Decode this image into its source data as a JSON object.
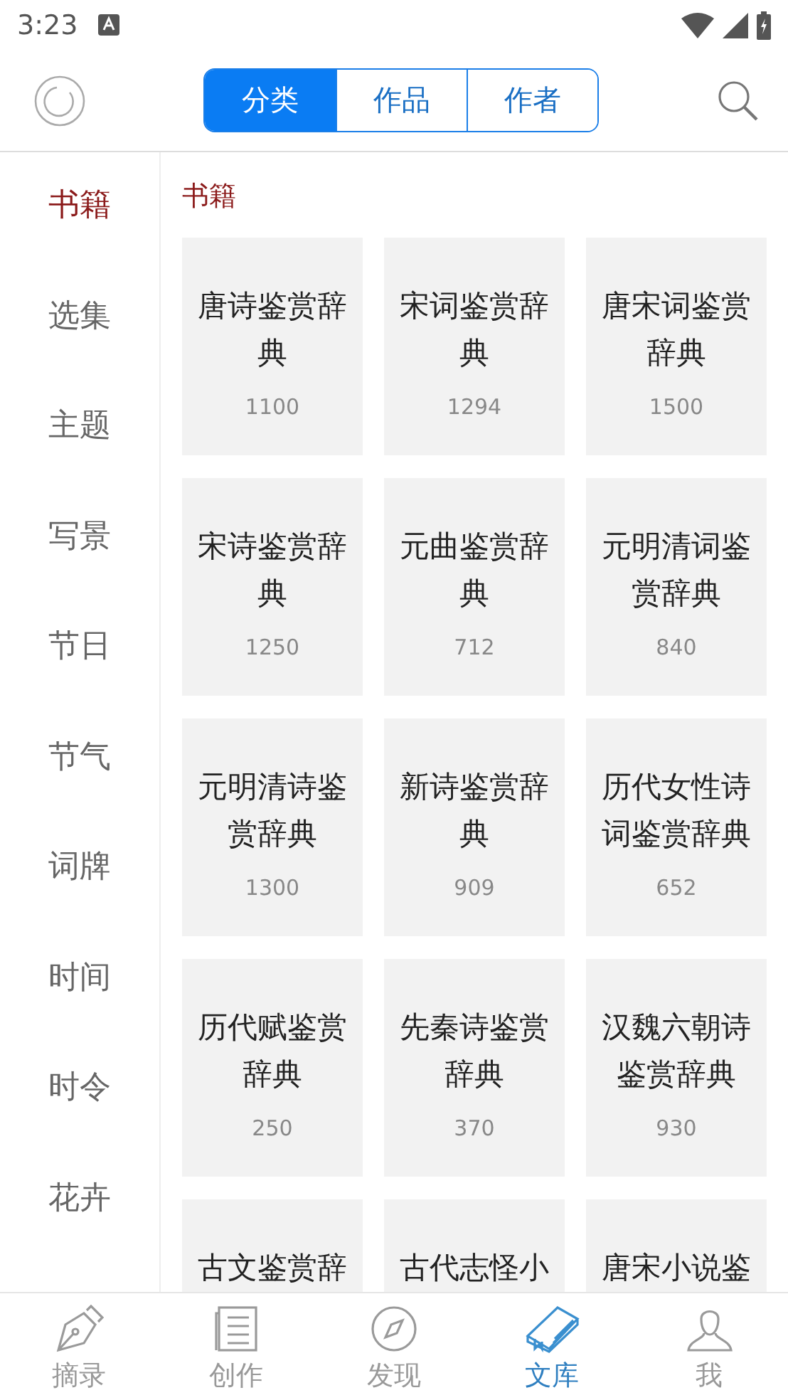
{
  "status_bar": {
    "time": "3:23"
  },
  "tabs": [
    {
      "label": "分类",
      "selected": true
    },
    {
      "label": "作品",
      "selected": false
    },
    {
      "label": "作者",
      "selected": false
    }
  ],
  "sidebar": {
    "items": [
      {
        "label": "书籍",
        "selected": true
      },
      {
        "label": "选集",
        "selected": false
      },
      {
        "label": "主题",
        "selected": false
      },
      {
        "label": "写景",
        "selected": false
      },
      {
        "label": "节日",
        "selected": false
      },
      {
        "label": "节气",
        "selected": false
      },
      {
        "label": "词牌",
        "selected": false
      },
      {
        "label": "时间",
        "selected": false
      },
      {
        "label": "时令",
        "selected": false
      },
      {
        "label": "花卉",
        "selected": false
      }
    ]
  },
  "section_title": "书籍",
  "books": [
    {
      "title": "唐诗鉴赏辞典",
      "count": "1100"
    },
    {
      "title": "宋词鉴赏辞典",
      "count": "1294"
    },
    {
      "title": "唐宋词鉴赏辞典",
      "count": "1500"
    },
    {
      "title": "宋诗鉴赏辞典",
      "count": "1250"
    },
    {
      "title": "元曲鉴赏辞典",
      "count": "712"
    },
    {
      "title": "元明清词鉴赏辞典",
      "count": "840"
    },
    {
      "title": "元明清诗鉴赏辞典",
      "count": "1300"
    },
    {
      "title": "新诗鉴赏辞典",
      "count": "909"
    },
    {
      "title": "历代女性诗词鉴赏辞典",
      "count": "652"
    },
    {
      "title": "历代赋鉴赏辞典",
      "count": "250"
    },
    {
      "title": "先秦诗鉴赏辞典",
      "count": "370"
    },
    {
      "title": "汉魏六朝诗鉴赏辞典",
      "count": "930"
    },
    {
      "title": "古文鉴赏辞"
    },
    {
      "title": "古代志怪小"
    },
    {
      "title": "唐宋小说鉴"
    }
  ],
  "bottom_nav": [
    {
      "label": "摘录",
      "kind": "pen",
      "selected": false
    },
    {
      "label": "创作",
      "kind": "page",
      "selected": false
    },
    {
      "label": "发现",
      "kind": "compass",
      "selected": false
    },
    {
      "label": "文库",
      "kind": "book",
      "selected": true
    },
    {
      "label": "我",
      "kind": "person",
      "selected": false
    }
  ]
}
